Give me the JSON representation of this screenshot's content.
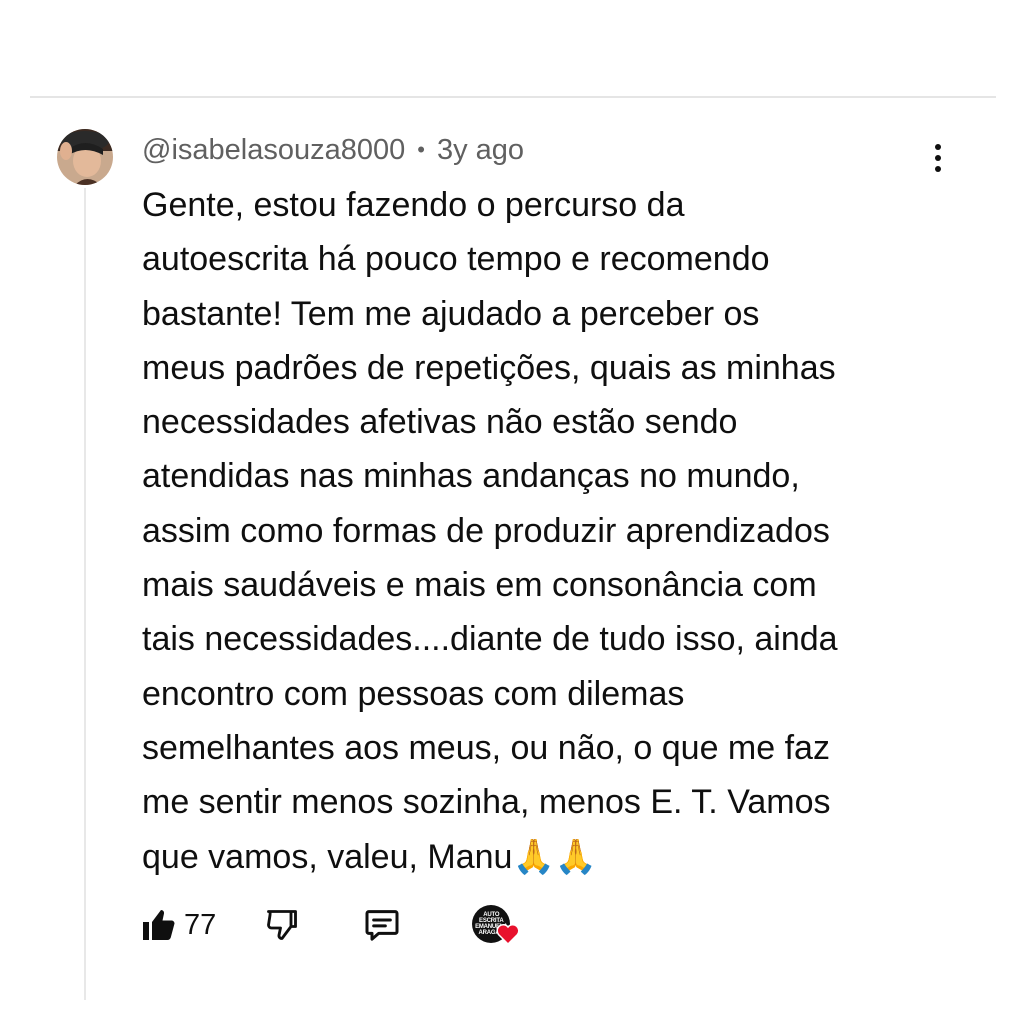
{
  "comment": {
    "username": "@isabelasouza8000",
    "separator": "•",
    "timestamp": "3y ago",
    "text": "Gente, estou fazendo o percurso da\nautoescrita há pouco tempo e recomendo\nbastante! Tem me ajudado a perceber os\nmeus padrões de repetições, quais as minhas\nnecessidades afetivas não estão sendo\natendidas nas minhas andanças no mundo,\nassim como formas de produzir aprendizados\nmais saudáveis e mais em  consonância com\ntais  necessidades....diante de tudo isso, ainda\nencontro com pessoas com dilemas\nsemelhantes aos meus, ou não, o que me faz\nme sentir menos  sozinha, menos E. T. Vamos\nque vamos, valeu, Manu",
    "emoji": "🙏🙏",
    "like_count": "77",
    "creator_avatar_text": "AUTO ESCRITA EMANUELA ARAGÃO"
  },
  "icons": {
    "more": "more-vertical-icon",
    "like": "thumbs-up-icon",
    "dislike": "thumbs-down-icon",
    "reply": "reply-icon",
    "heart": "heart-icon"
  },
  "colors": {
    "text": "#0f0f0f",
    "meta": "#606060",
    "heart": "#e8112d",
    "divider": "#e5e5e5"
  }
}
